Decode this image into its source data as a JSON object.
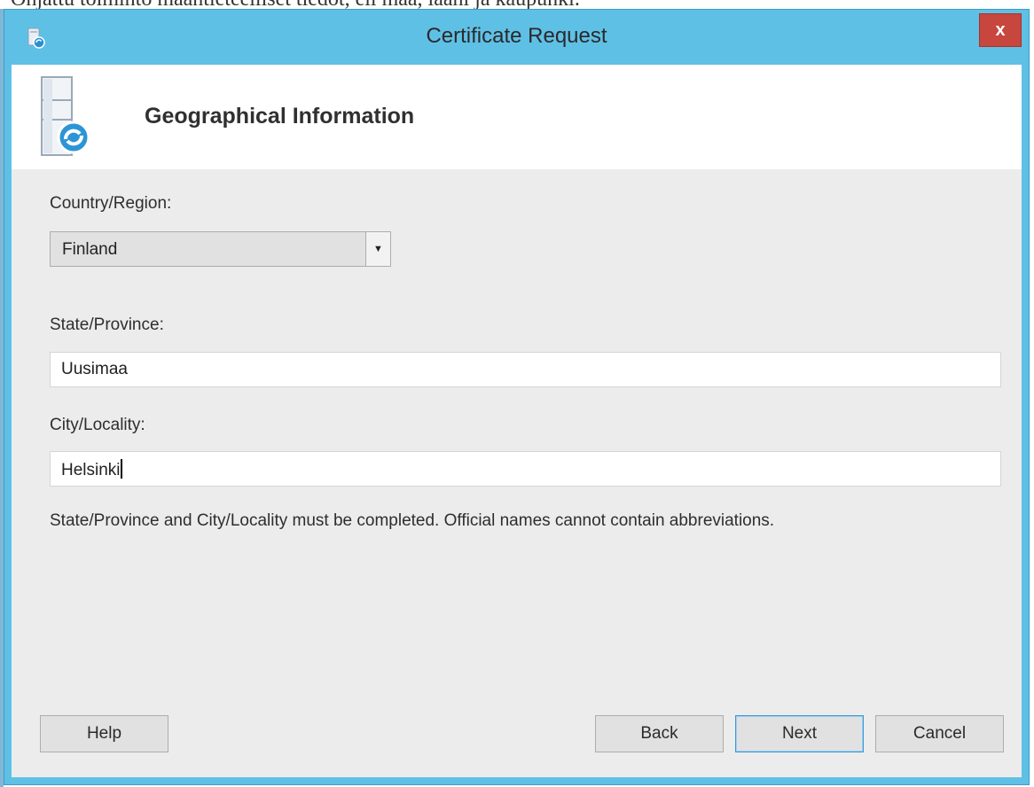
{
  "top_strip": {
    "text": "Ohjattu toiminto maantieteelliset tiedot, eli maa, lääni ja kaupunki."
  },
  "window": {
    "title": "Certificate Request",
    "close_label": "x"
  },
  "header": {
    "title": "Geographical Information",
    "icon": "certificate-server-icon"
  },
  "form": {
    "country_label": "Country/Region:",
    "country_value": "Finland",
    "state_label": "State/Province:",
    "state_value": "Uusimaa",
    "city_label": "City/Locality:",
    "city_value": "Helsinki"
  },
  "note": "State/Province and City/Locality must be completed. Official names cannot contain abbreviations.",
  "buttons": {
    "help": "Help",
    "back": "Back",
    "next": "Next",
    "cancel": "Cancel"
  },
  "colors": {
    "window_frame": "#5fc0e6",
    "close_button": "#c7463d",
    "content_background": "#ececec",
    "header_background": "#ffffff"
  }
}
